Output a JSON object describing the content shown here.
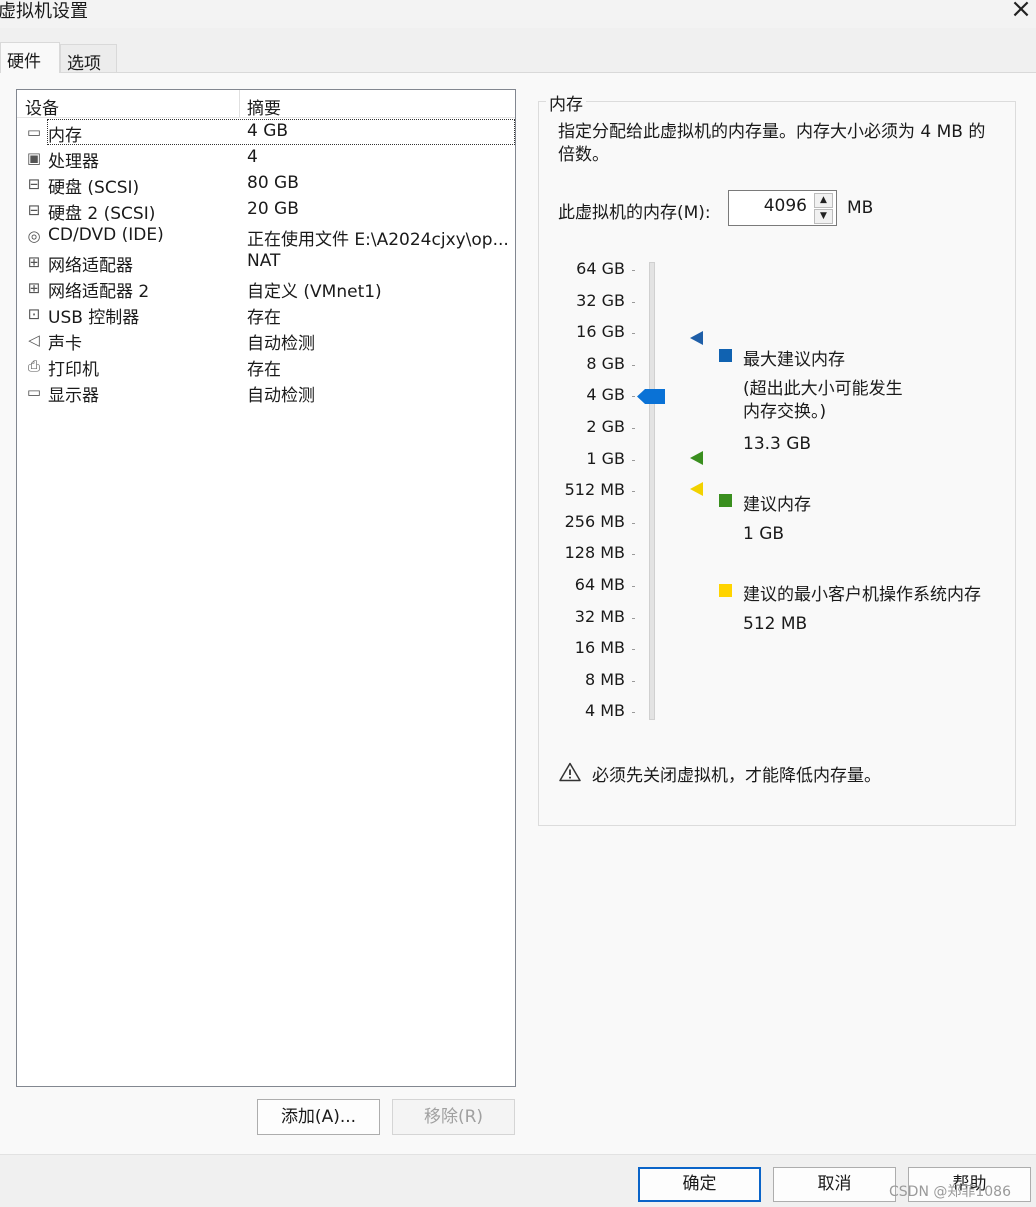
{
  "window": {
    "title": "虚拟机设置",
    "close_icon": "×"
  },
  "tabs": [
    {
      "label": "硬件"
    },
    {
      "label": "选项"
    }
  ],
  "device_list": {
    "headers": {
      "device": "设备",
      "summary": "摘要"
    },
    "rows": [
      {
        "icon": "memory-icon",
        "glyph": "▭",
        "name": "内存",
        "summary": "4 GB"
      },
      {
        "icon": "processor-icon",
        "glyph": "▣",
        "name": "处理器",
        "summary": "4"
      },
      {
        "icon": "hard-disk-icon",
        "glyph": "⊟",
        "name": "硬盘 (SCSI)",
        "summary": "80 GB"
      },
      {
        "icon": "hard-disk-icon",
        "glyph": "⊟",
        "name": "硬盘 2 (SCSI)",
        "summary": "20 GB"
      },
      {
        "icon": "cd-dvd-icon",
        "glyph": "◎",
        "name": "CD/DVD (IDE)",
        "summary": "正在使用文件 E:\\A2024cjxy\\op..."
      },
      {
        "icon": "network-adapter-icon",
        "glyph": "⊞",
        "name": "网络适配器",
        "summary": "NAT"
      },
      {
        "icon": "network-adapter-icon",
        "glyph": "⊞",
        "name": "网络适配器 2",
        "summary": "自定义 (VMnet1)"
      },
      {
        "icon": "usb-icon",
        "glyph": "⊡",
        "name": "USB 控制器",
        "summary": "存在"
      },
      {
        "icon": "sound-icon",
        "glyph": "◁",
        "name": "声卡",
        "summary": "自动检测"
      },
      {
        "icon": "printer-icon",
        "glyph": "⎙",
        "name": "打印机",
        "summary": "存在"
      },
      {
        "icon": "display-icon",
        "glyph": "▭",
        "name": "显示器",
        "summary": "自动检测"
      }
    ],
    "selected_index": 0
  },
  "list_buttons": {
    "add": "添加(A)...",
    "remove": "移除(R)"
  },
  "memory": {
    "group_title": "内存",
    "description": "指定分配给此虚拟机的内存量。内存大小必须为 4 MB 的倍数。",
    "field_label": "此虚拟机的内存(M):",
    "value": "4096",
    "unit": "MB",
    "scale_labels": [
      "64 GB",
      "32 GB",
      "16 GB",
      "8 GB",
      "4 GB",
      "2 GB",
      "1 GB",
      "512 MB",
      "256 MB",
      "128 MB",
      "64 MB",
      "32 MB",
      "16 MB",
      "8 MB",
      "4 MB"
    ],
    "slider_value": "4 GB",
    "legend": {
      "max": {
        "title": "最大建议内存",
        "note": "(超出此大小可能发生内存交换。)",
        "value": "13.3 GB",
        "color": "#1062b1"
      },
      "recommended": {
        "title": "建议内存",
        "value": "1 GB",
        "color": "#3a8f1f"
      },
      "min": {
        "title": "建议的最小客户机操作系统内存",
        "value": "512 MB",
        "color": "#ffd400"
      }
    },
    "warning": "必须先关闭虚拟机，才能降低内存量。"
  },
  "dialog_buttons": {
    "ok": "确定",
    "cancel": "取消",
    "help": "帮助"
  },
  "watermark": "CSDN @郑菲1086"
}
